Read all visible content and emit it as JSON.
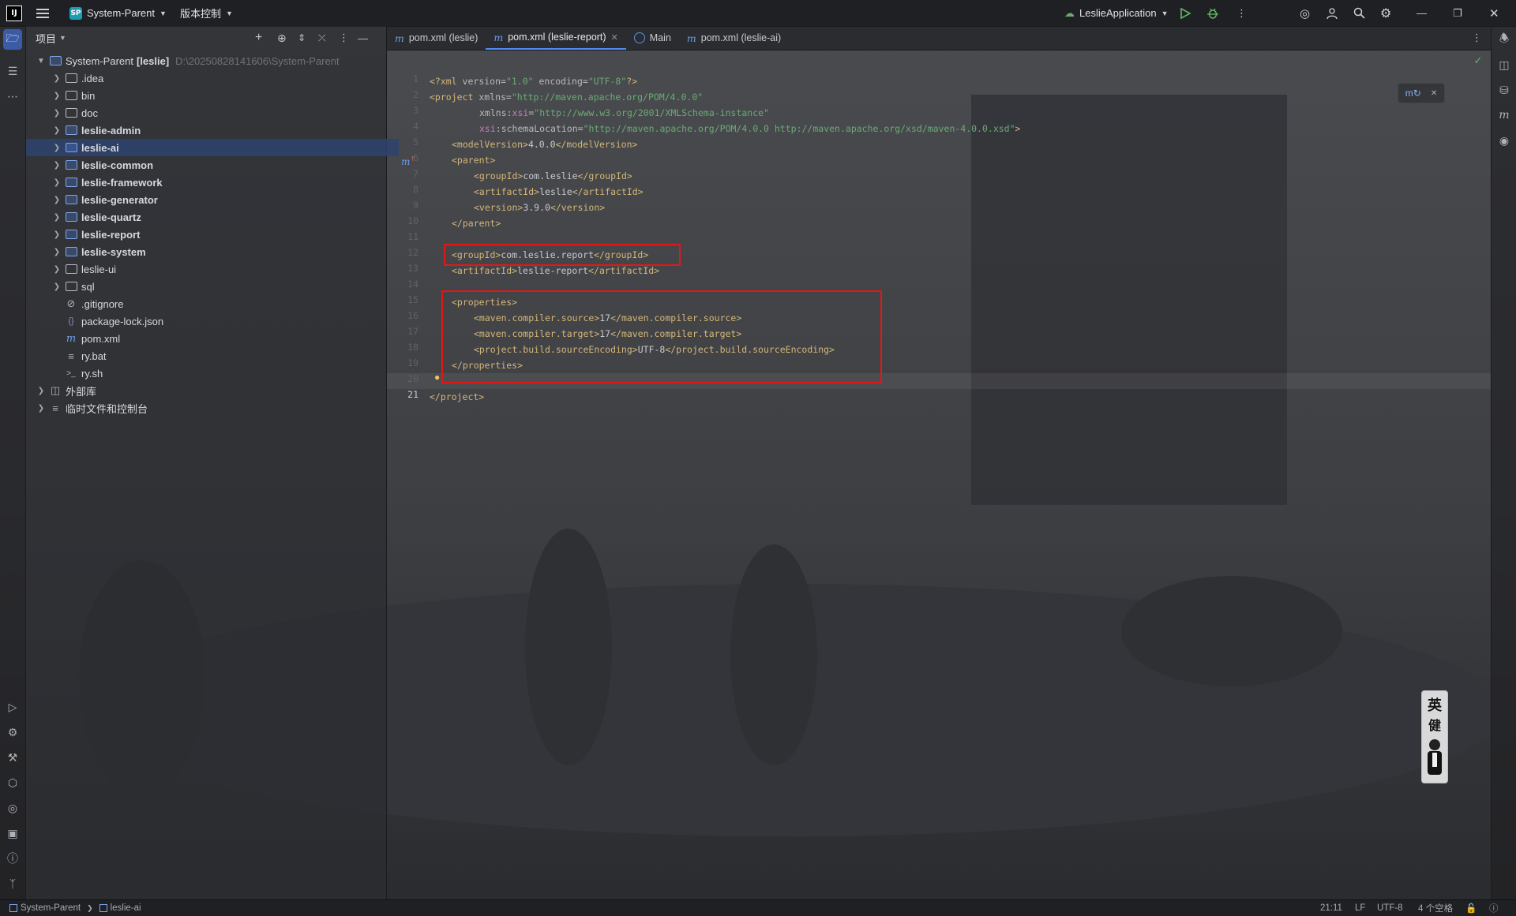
{
  "titlebar": {
    "app_badge": "IJ",
    "project_badge": "SP",
    "project_name": "System-Parent",
    "vcs_menu": "版本控制",
    "run_config": "LeslieApplication"
  },
  "project_panel": {
    "title": "项目",
    "root": {
      "name": "System-Parent",
      "module": "[leslie]",
      "path": "D:\\20250828141606\\System-Parent"
    },
    "items": [
      {
        "label": ".idea",
        "type": "folder",
        "bold": false
      },
      {
        "label": "bin",
        "type": "folder",
        "bold": false
      },
      {
        "label": "doc",
        "type": "folder",
        "bold": false
      },
      {
        "label": "leslie-admin",
        "type": "module",
        "bold": true
      },
      {
        "label": "leslie-ai",
        "type": "module",
        "bold": true,
        "selected": true
      },
      {
        "label": "leslie-common",
        "type": "module",
        "bold": true
      },
      {
        "label": "leslie-framework",
        "type": "module",
        "bold": true
      },
      {
        "label": "leslie-generator",
        "type": "module",
        "bold": true
      },
      {
        "label": "leslie-quartz",
        "type": "module",
        "bold": true
      },
      {
        "label": "leslie-report",
        "type": "module",
        "bold": true
      },
      {
        "label": "leslie-system",
        "type": "module",
        "bold": true
      },
      {
        "label": "leslie-ui",
        "type": "folder",
        "bold": false
      },
      {
        "label": "sql",
        "type": "folder",
        "bold": false
      },
      {
        "label": ".gitignore",
        "type": "file",
        "bold": false
      },
      {
        "label": "package-lock.json",
        "type": "file",
        "bold": false
      },
      {
        "label": "pom.xml",
        "type": "file",
        "bold": false
      },
      {
        "label": "ry.bat",
        "type": "file",
        "bold": false
      },
      {
        "label": "ry.sh",
        "type": "file",
        "bold": false
      }
    ],
    "external_libs": "外部库",
    "scratches": "临时文件和控制台"
  },
  "tabs": [
    {
      "label": "pom.xml (leslie)"
    },
    {
      "label": "pom.xml (leslie-report)",
      "active": true
    },
    {
      "label": "Main"
    },
    {
      "label": "pom.xml (leslie-ai)"
    }
  ],
  "code": {
    "line_numbers": [
      "1",
      "2",
      "3",
      "4",
      "5",
      "6",
      "7",
      "8",
      "9",
      "10",
      "11",
      "12",
      "13",
      "14",
      "15",
      "16",
      "17",
      "18",
      "19",
      "20",
      "21"
    ],
    "l1": {
      "pi_open": "<?xml ",
      "ver_attr": "version=",
      "ver_val": "\"1.0\"",
      "enc_attr": " encoding=",
      "enc_val": "\"UTF-8\"",
      "pi_close": "?>"
    },
    "l2": {
      "open": "<project ",
      "attr": "xmlns=",
      "val": "\"http://maven.apache.org/POM/4.0.0\""
    },
    "l3": {
      "attr": "xmlns:",
      "ns": "xsi",
      "eq": "=",
      "val": "\"http://www.w3.org/2001/XMLSchema-instance\""
    },
    "l4": {
      "ns": "xsi",
      "attr": ":schemaLocation=",
      "val": "\"http://maven.apache.org/POM/4.0.0 http://maven.apache.org/xsd/maven-4.0.0.xsd\"",
      "close": ">"
    },
    "l5": {
      "open": "<modelVersion>",
      "text": "4.0.0",
      "close": "</modelVersion>"
    },
    "l6": {
      "open": "<parent>"
    },
    "l7": {
      "open": "<groupId>",
      "text": "com.leslie",
      "close": "</groupId>"
    },
    "l8": {
      "open": "<artifactId>",
      "text": "leslie",
      "close": "</artifactId>"
    },
    "l9": {
      "open": "<version>",
      "text": "3.9.0",
      "close": "</version>"
    },
    "l10": {
      "close": "</parent>"
    },
    "l12": {
      "open": "<groupId>",
      "text": "com.leslie.report",
      "close": "</groupId>"
    },
    "l13": {
      "open": "<artifactId>",
      "text": "leslie-report",
      "close": "</artifactId>"
    },
    "l15": {
      "open": "<properties>"
    },
    "l16": {
      "open": "<maven.compiler.source>",
      "text": "17",
      "close": "</maven.compiler.source>"
    },
    "l17": {
      "open": "<maven.compiler.target>",
      "text": "17",
      "close": "</maven.compiler.target>"
    },
    "l18": {
      "open": "<project.build.sourceEncoding>",
      "text": "UTF-8",
      "close": "</project.build.sourceEncoding>"
    },
    "l19": {
      "close": "</properties>"
    },
    "l21": {
      "close": "</project>"
    }
  },
  "statusbar": {
    "crumb_root": "System-Parent",
    "crumb_module": "leslie-ai",
    "position": "21:11",
    "line_sep": "LF",
    "encoding": "UTF-8",
    "indent": "4 个空格"
  },
  "badge_chars": [
    "英",
    "健"
  ]
}
